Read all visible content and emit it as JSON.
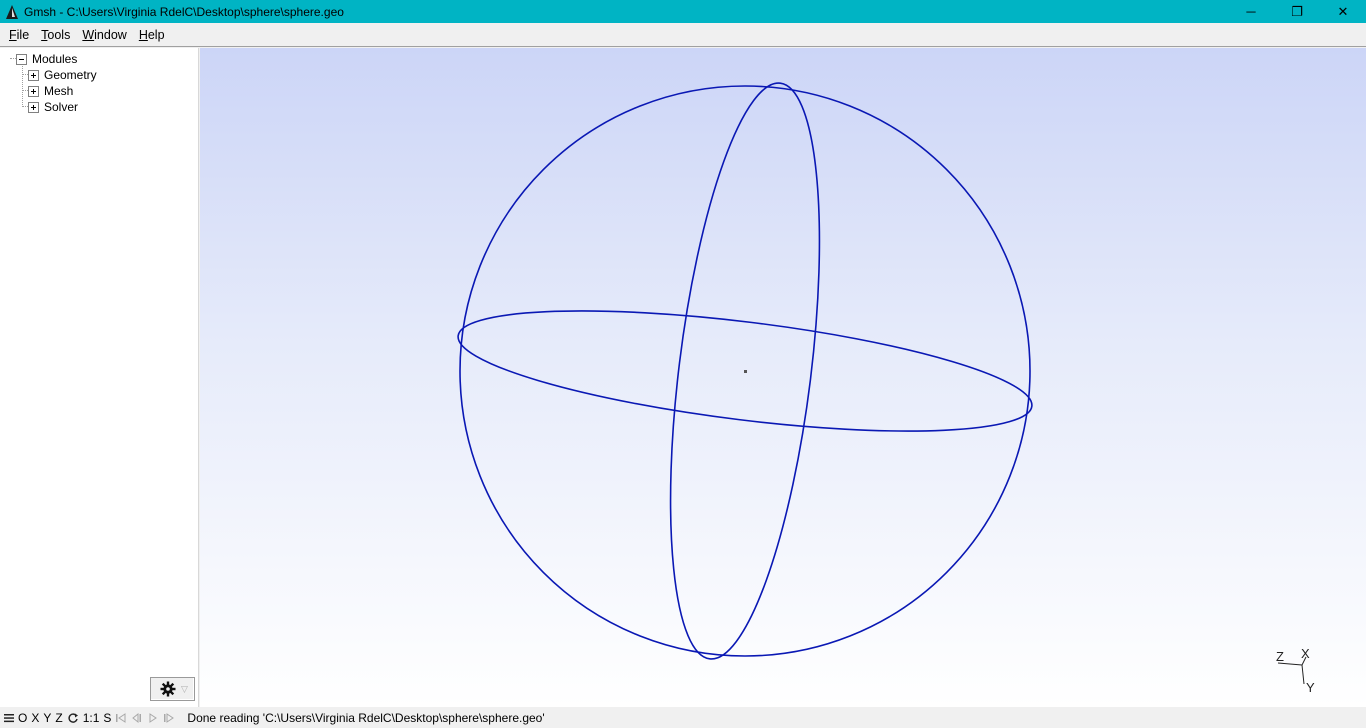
{
  "window": {
    "title": "Gmsh - C:\\Users\\Virginia RdelC\\Desktop\\sphere\\sphere.geo",
    "controls": {
      "minimize": "─",
      "restore": "❐",
      "close": "✕"
    }
  },
  "menu": [
    {
      "label": "File",
      "key": "F",
      "rest": "ile"
    },
    {
      "label": "Tools",
      "key": "T",
      "rest": "ools"
    },
    {
      "label": "Window",
      "key": "W",
      "rest": "indow"
    },
    {
      "label": "Help",
      "key": "H",
      "rest": "elp"
    }
  ],
  "tree": {
    "root": "Modules",
    "children": [
      "Geometry",
      "Mesh",
      "Solver"
    ]
  },
  "axes": {
    "z": "Z",
    "x": "X",
    "y": "Y"
  },
  "statusbar": {
    "buttons": [
      "O",
      "X",
      "Y",
      "Z"
    ],
    "scale": "1:1",
    "s": "S",
    "message": "Done reading 'C:\\Users\\Virginia RdelC\\Desktop\\sphere\\sphere.geo'"
  },
  "colors": {
    "titlebar": "#00b4c4",
    "curve": "#0a18b4",
    "viewport_top": "#ccd5f7",
    "viewport_bottom": "#ffffff"
  }
}
